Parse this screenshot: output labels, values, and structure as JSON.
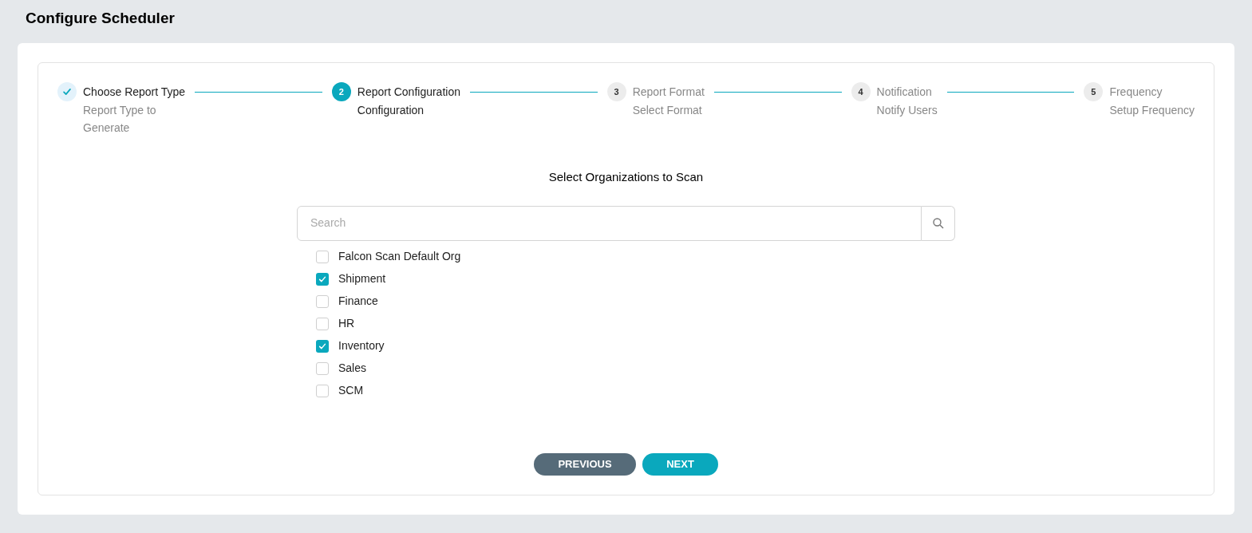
{
  "page_title": "Configure Scheduler",
  "steps": [
    {
      "title": "Choose Report Type",
      "subtitle": "Report Type to Generate",
      "completed": true,
      "selected": false
    },
    {
      "number": "2",
      "title": "Report Configuration",
      "subtitle": "Configuration",
      "completed": false,
      "selected": true
    },
    {
      "number": "3",
      "title": "Report Format",
      "subtitle": "Select Format",
      "completed": false,
      "selected": false
    },
    {
      "number": "4",
      "title": "Notification",
      "subtitle": "Notify Users",
      "completed": false,
      "selected": false
    },
    {
      "number": "5",
      "title": "Frequency",
      "subtitle": "Setup Frequency",
      "completed": false,
      "selected": false
    }
  ],
  "section_title": "Select Organizations to Scan",
  "search": {
    "placeholder": "Search"
  },
  "organizations": [
    {
      "label": "Falcon Scan Default Org",
      "checked": false
    },
    {
      "label": "Shipment",
      "checked": true
    },
    {
      "label": "Finance",
      "checked": false
    },
    {
      "label": "HR",
      "checked": false
    },
    {
      "label": "Inventory",
      "checked": true
    },
    {
      "label": "Sales",
      "checked": false
    },
    {
      "label": "SCM",
      "checked": false
    }
  ],
  "buttons": [
    {
      "label": "PREVIOUS",
      "kind": "secondary"
    },
    {
      "label": "NEXT",
      "kind": "primary"
    }
  ]
}
